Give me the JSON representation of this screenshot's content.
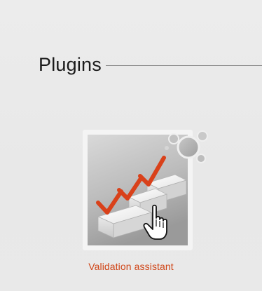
{
  "section": {
    "title": "Plugins"
  },
  "plugins": [
    {
      "label": "Validation assistant",
      "icon": "validation-assistant-icon",
      "accent_color": "#d04618"
    }
  ],
  "colors": {
    "background": "#e9e9e9",
    "label": "#d04618",
    "checkmark": "#d9411a"
  }
}
